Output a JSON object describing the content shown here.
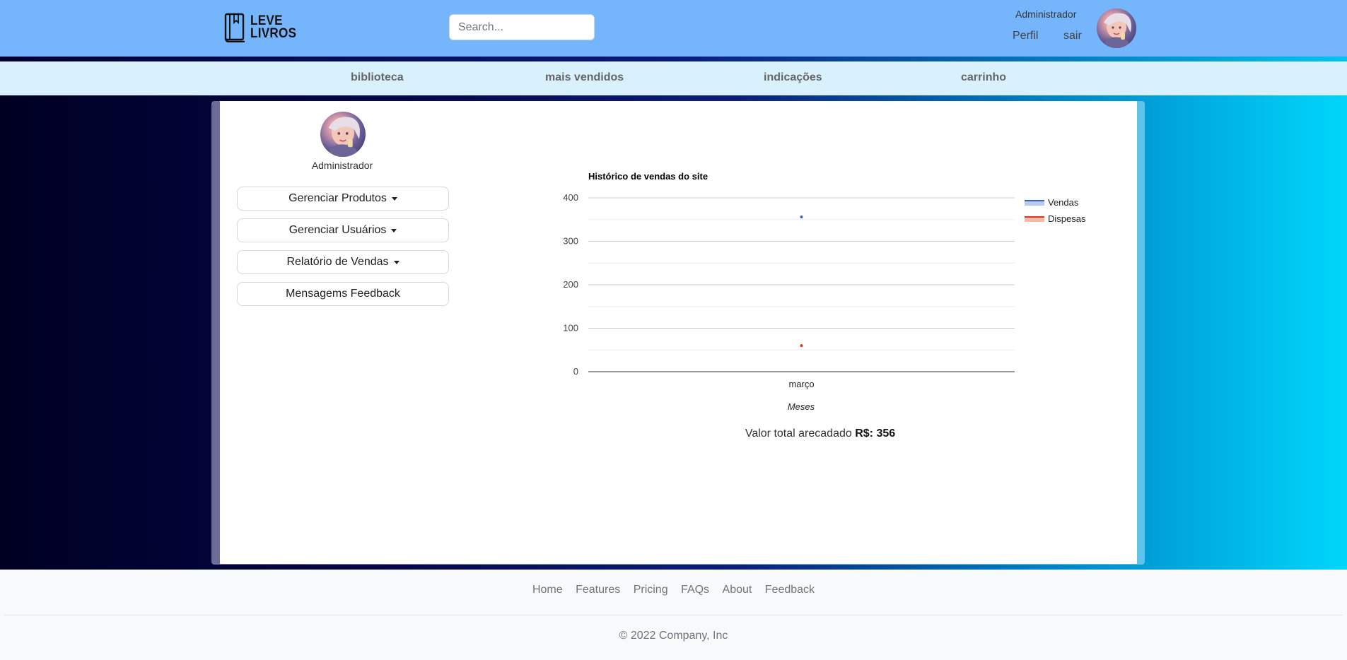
{
  "header": {
    "logo_line1": "LEVE",
    "logo_line2": "LIVROS",
    "search_placeholder": "Search...",
    "user_name": "Administrador",
    "profile_link": "Perfil",
    "logout_link": "sair"
  },
  "nav": {
    "items": [
      {
        "label": "biblioteca"
      },
      {
        "label": "mais vendidos"
      },
      {
        "label": "indicações"
      },
      {
        "label": "carrinho"
      }
    ]
  },
  "sidebar": {
    "user_name": "Administrador",
    "buttons": [
      {
        "label": "Gerenciar Produtos"
      },
      {
        "label": "Gerenciar Usuários"
      },
      {
        "label": "Relatório de Vendas"
      },
      {
        "label": "Mensagems Feedback"
      }
    ]
  },
  "chart_data": {
    "type": "line",
    "title": "Histórico de vendas do site",
    "xlabel": "Meses",
    "ylabel": "",
    "categories": [
      "março"
    ],
    "series": [
      {
        "name": "Vendas",
        "values": [
          356
        ],
        "color": "#3366cc"
      },
      {
        "name": "Dispesas",
        "values": [
          60
        ],
        "color": "#dc3912"
      }
    ],
    "ylim": [
      0,
      400
    ],
    "yticks": [
      "0",
      "100",
      "200",
      "300",
      "400"
    ],
    "grid": true,
    "legend": "right"
  },
  "summary": {
    "label": "Valor total arecadado",
    "value": "R$: 356"
  },
  "footer": {
    "links": [
      {
        "label": "Home"
      },
      {
        "label": "Features"
      },
      {
        "label": "Pricing"
      },
      {
        "label": "FAQs"
      },
      {
        "label": "About"
      },
      {
        "label": "Feedback"
      }
    ],
    "copyright": "© 2022 Company, Inc"
  },
  "colors": {
    "header_bg": "#74b5fb",
    "nav_bg": "#d9f0fd",
    "sales_series": "#3366cc",
    "expenses_series": "#dc3912"
  }
}
